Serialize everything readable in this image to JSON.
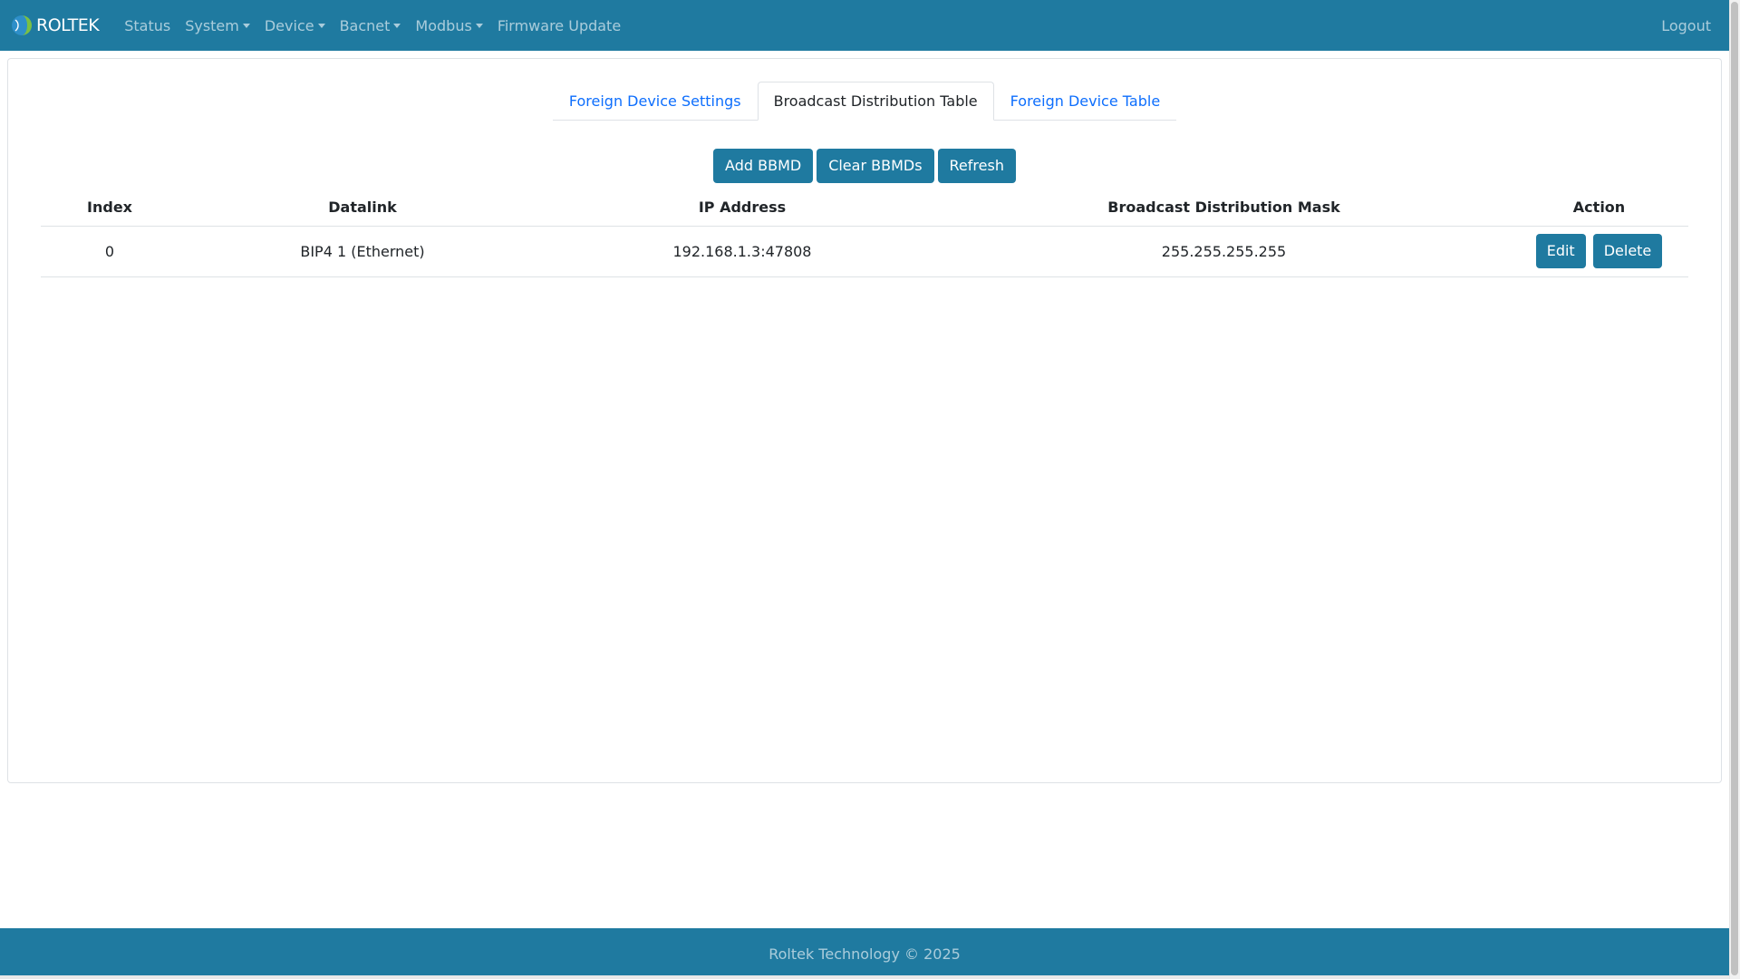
{
  "navbar": {
    "brand": "ROLTEK",
    "links": [
      {
        "label": "Status",
        "dropdown": false
      },
      {
        "label": "System",
        "dropdown": true
      },
      {
        "label": "Device",
        "dropdown": true
      },
      {
        "label": "Bacnet",
        "dropdown": true
      },
      {
        "label": "Modbus",
        "dropdown": true
      },
      {
        "label": "Firmware Update",
        "dropdown": false
      }
    ],
    "logout": "Logout"
  },
  "tabs": [
    {
      "label": "Foreign Device Settings",
      "active": false
    },
    {
      "label": "Broadcast Distribution Table",
      "active": true
    },
    {
      "label": "Foreign Device Table",
      "active": false
    }
  ],
  "buttons": {
    "add": "Add BBMD",
    "clear": "Clear BBMDs",
    "refresh": "Refresh"
  },
  "table": {
    "headers": [
      "Index",
      "Datalink",
      "IP Address",
      "Broadcast Distribution Mask",
      "Action"
    ],
    "rows": [
      {
        "index": "0",
        "datalink": "BIP4 1 (Ethernet)",
        "ip": "192.168.1.3:47808",
        "mask": "255.255.255.255",
        "edit": "Edit",
        "delete": "Delete"
      }
    ]
  },
  "footer": {
    "text": "Roltek Technology © 2025"
  },
  "colors": {
    "primary": "#1f7aa0",
    "link": "#0d6efd"
  },
  "icons": {
    "brand": "roltek-logo-icon",
    "dropdown": "caret-down-icon"
  }
}
